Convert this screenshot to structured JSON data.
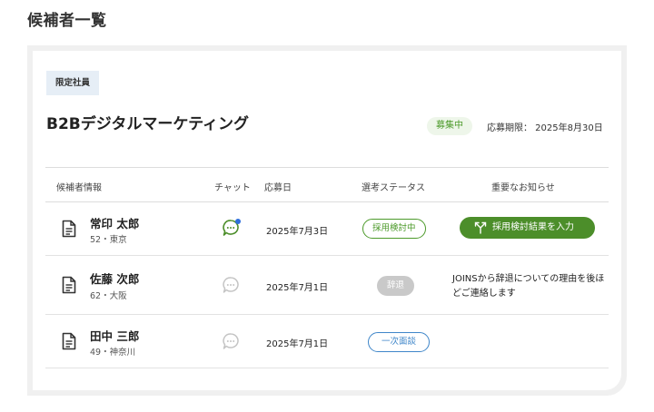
{
  "page": {
    "title": "候補者一覧"
  },
  "job": {
    "tag": "限定社員",
    "title": "B2Bデジタルマーケティング",
    "status": "募集中",
    "deadline": "応募期限： 2025年8月30日"
  },
  "table": {
    "headers": {
      "info": "候補者情報",
      "chat": "チャット",
      "applied": "応募日",
      "status": "選考ステータス",
      "notice": "重要なお知らせ"
    },
    "rows": [
      {
        "name": "常印 太郎",
        "meta": "52・東京",
        "chat_unread": true,
        "applied": "2025年7月3日",
        "status": "採用検討中",
        "action_label": "採用検討結果を入力",
        "notice": ""
      },
      {
        "name": "佐藤 次郎",
        "meta": "62・大阪",
        "chat_unread": false,
        "applied": "2025年7月1日",
        "status": "辞退",
        "action_label": "",
        "notice": "JOINSから辞退についての理由を後ほどご連絡します"
      },
      {
        "name": "田中 三郎",
        "meta": "49・神奈川",
        "chat_unread": false,
        "applied": "2025年7月1日",
        "status": "一次面談",
        "action_label": "",
        "notice": ""
      }
    ]
  },
  "icons": {
    "document": "document-icon",
    "chat": "chat-bubble-icon",
    "action": "branch-icon"
  },
  "colors": {
    "green": "#4c8e2a",
    "blue": "#3f86c9",
    "gray_badge": "#c9c9c9",
    "unread_dot": "#2f6fdc",
    "tag_bg": "#e6eef6"
  }
}
